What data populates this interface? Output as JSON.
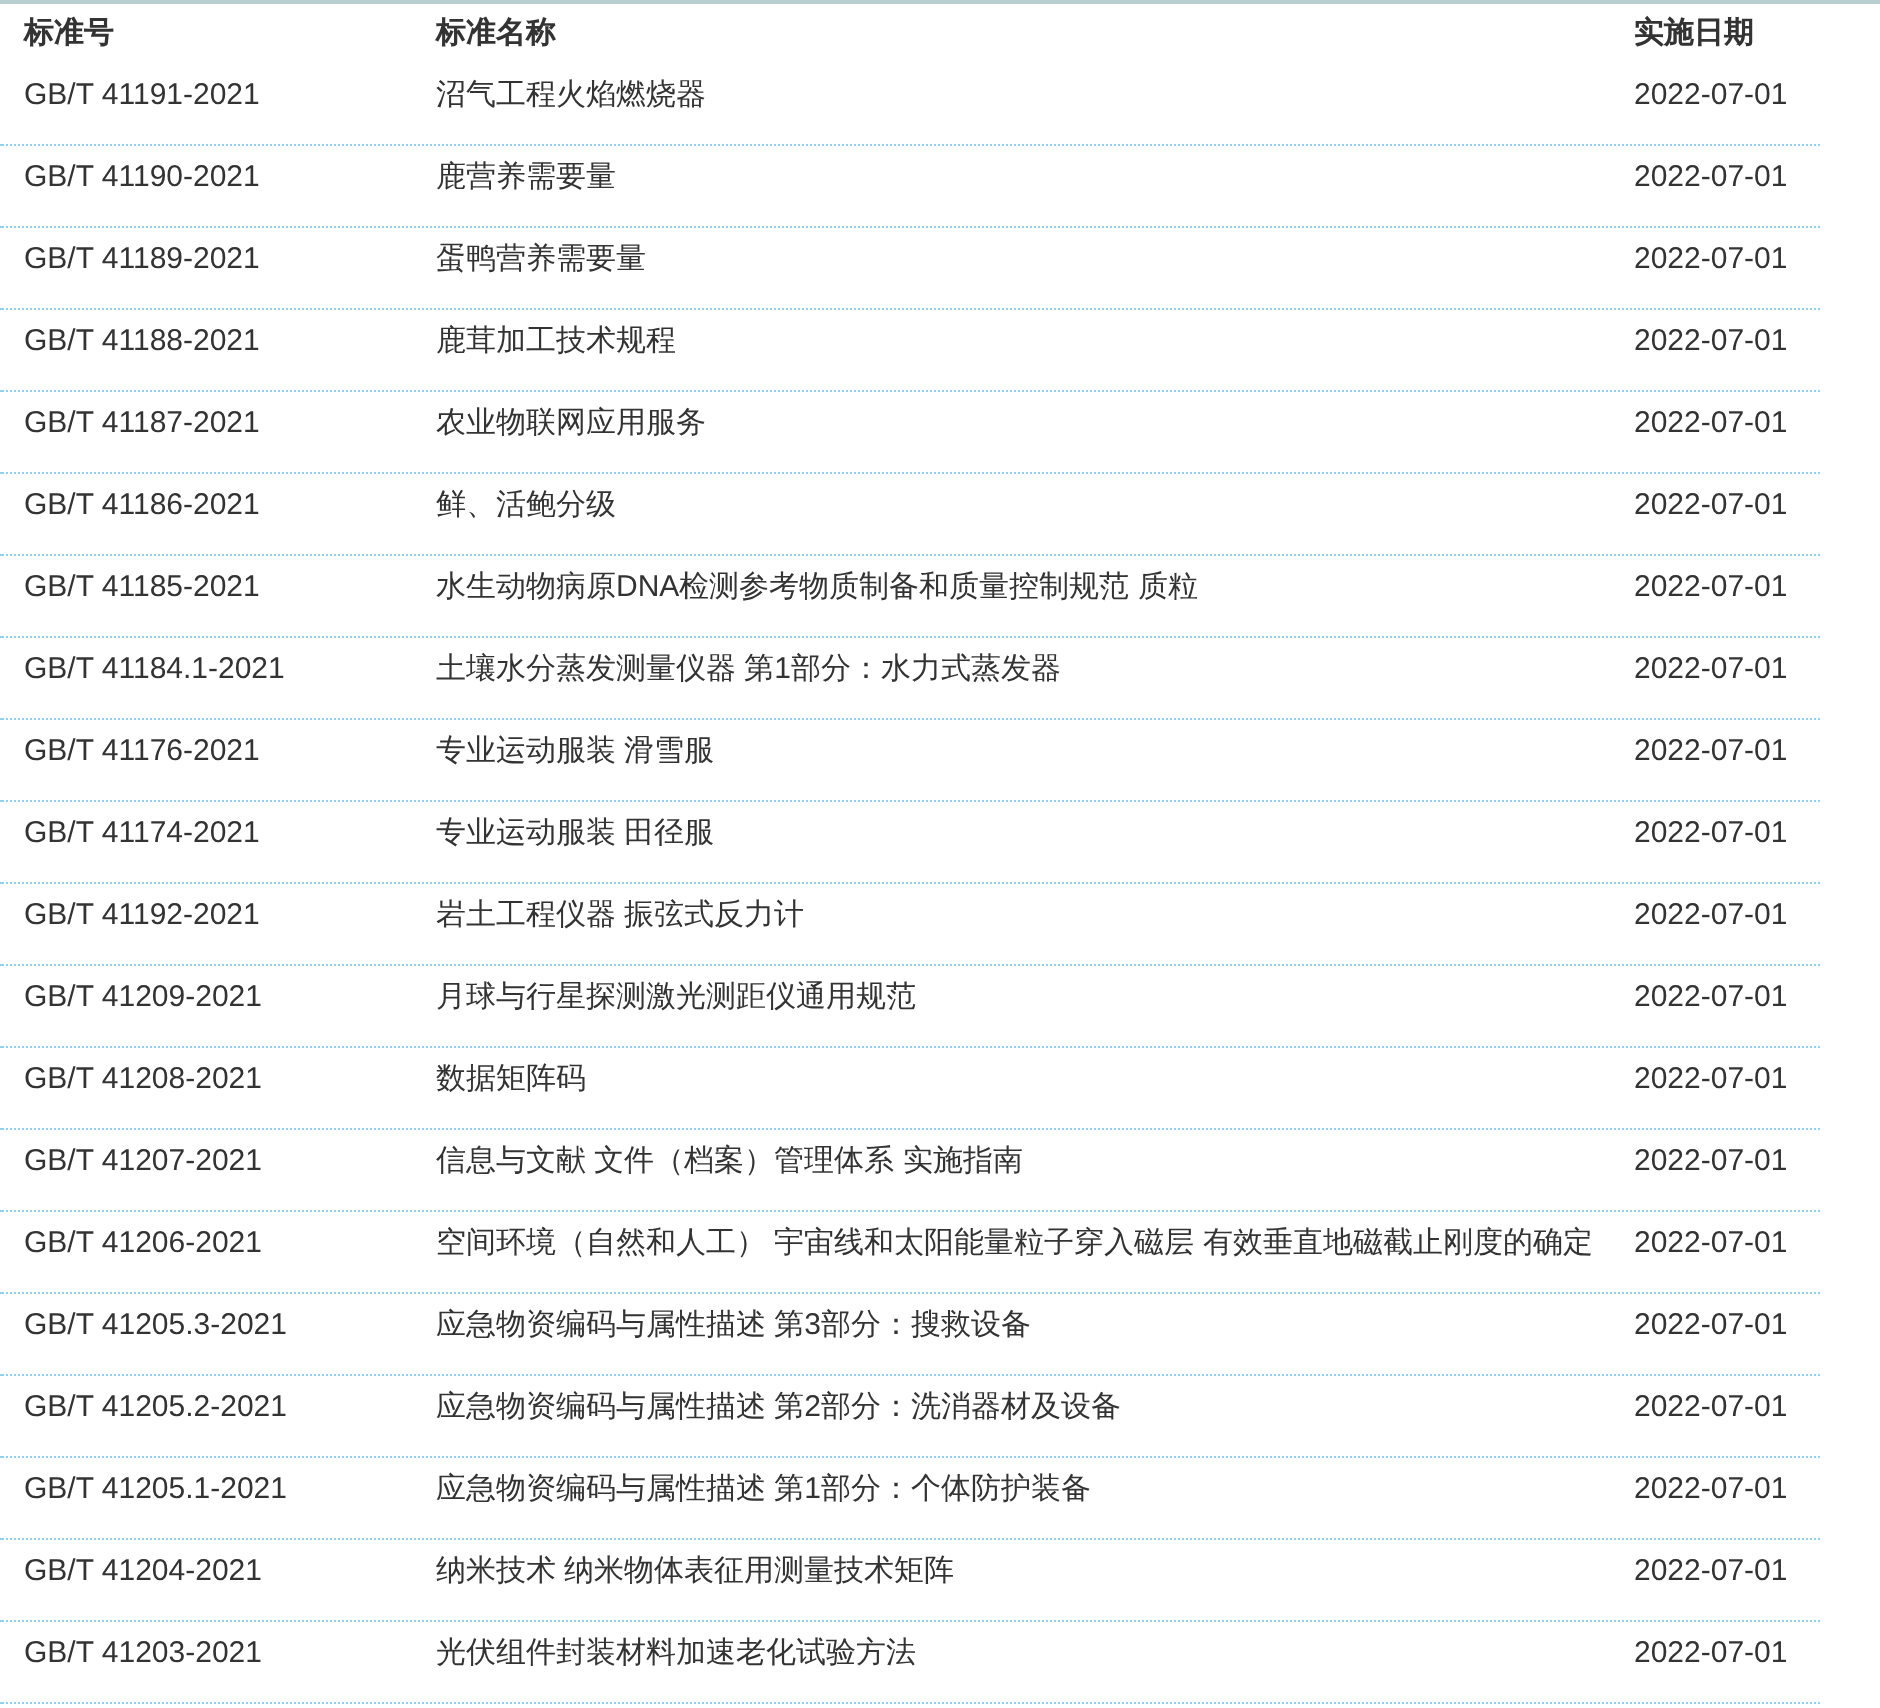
{
  "table": {
    "columns": [
      "标准号",
      "标准名称",
      "实施日期"
    ],
    "rows": [
      {
        "code": "GB/T 41191-2021",
        "name": "沼气工程火焰燃烧器",
        "date": "2022-07-01"
      },
      {
        "code": "GB/T 41190-2021",
        "name": "鹿营养需要量",
        "date": "2022-07-01"
      },
      {
        "code": "GB/T 41189-2021",
        "name": "蛋鸭营养需要量",
        "date": "2022-07-01"
      },
      {
        "code": "GB/T 41188-2021",
        "name": "鹿茸加工技术规程",
        "date": "2022-07-01"
      },
      {
        "code": "GB/T 41187-2021",
        "name": "农业物联网应用服务",
        "date": "2022-07-01"
      },
      {
        "code": "GB/T 41186-2021",
        "name": "鲜、活鲍分级",
        "date": "2022-07-01"
      },
      {
        "code": "GB/T 41185-2021",
        "name": "水生动物病原DNA检测参考物质制备和质量控制规范 质粒",
        "date": "2022-07-01"
      },
      {
        "code": "GB/T 41184.1-2021",
        "name": "土壤水分蒸发测量仪器 第1部分：水力式蒸发器",
        "date": "2022-07-01"
      },
      {
        "code": "GB/T 41176-2021",
        "name": "专业运动服装 滑雪服",
        "date": "2022-07-01"
      },
      {
        "code": "GB/T 41174-2021",
        "name": "专业运动服装 田径服",
        "date": "2022-07-01"
      },
      {
        "code": "GB/T 41192-2021",
        "name": "岩土工程仪器 振弦式反力计",
        "date": "2022-07-01"
      },
      {
        "code": "GB/T 41209-2021",
        "name": "月球与行星探测激光测距仪通用规范",
        "date": "2022-07-01"
      },
      {
        "code": "GB/T 41208-2021",
        "name": "数据矩阵码",
        "date": "2022-07-01"
      },
      {
        "code": "GB/T 41207-2021",
        "name": "信息与文献 文件（档案）管理体系 实施指南",
        "date": "2022-07-01"
      },
      {
        "code": "GB/T 41206-2021",
        "name": "空间环境（自然和人工） 宇宙线和太阳能量粒子穿入磁层 有效垂直地磁截止刚度的确定",
        "date": "2022-07-01"
      },
      {
        "code": "GB/T 41205.3-2021",
        "name": "应急物资编码与属性描述 第3部分：搜救设备",
        "date": "2022-07-01"
      },
      {
        "code": "GB/T 41205.2-2021",
        "name": "应急物资编码与属性描述 第2部分：洗消器材及设备",
        "date": "2022-07-01"
      },
      {
        "code": "GB/T 41205.1-2021",
        "name": "应急物资编码与属性描述 第1部分：个体防护装备",
        "date": "2022-07-01"
      },
      {
        "code": "GB/T 41204-2021",
        "name": "纳米技术 纳米物体表征用测量技术矩阵",
        "date": "2022-07-01"
      },
      {
        "code": "GB/T 41203-2021",
        "name": "光伏组件封装材料加速老化试验方法",
        "date": "2022-07-01"
      }
    ]
  }
}
